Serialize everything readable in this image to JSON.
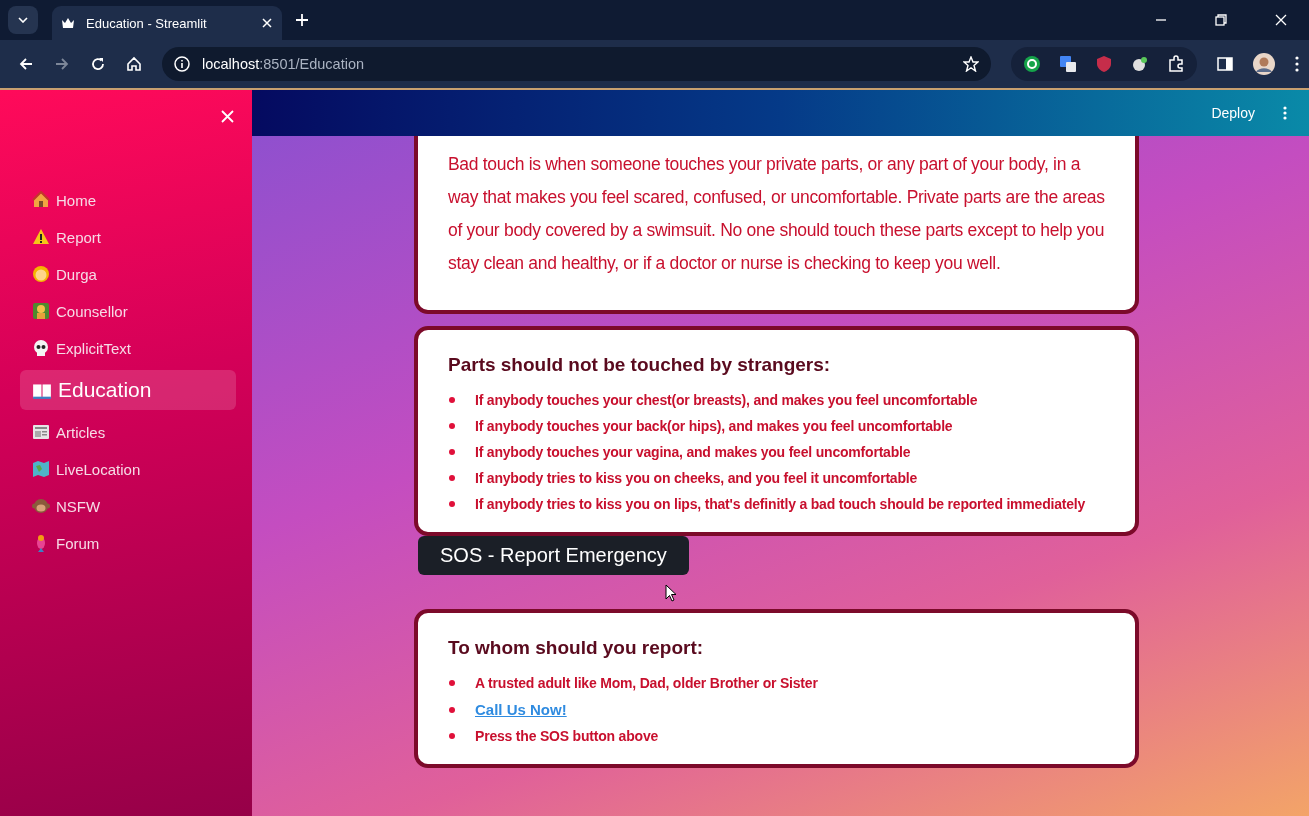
{
  "browser": {
    "tab_title": "Education - Streamlit",
    "url_host": "localhost",
    "url_path": ":8501/Education"
  },
  "sidebar": {
    "items": [
      {
        "label": "Home",
        "selected": false
      },
      {
        "label": "Report",
        "selected": false
      },
      {
        "label": "Durga",
        "selected": false
      },
      {
        "label": "Counsellor",
        "selected": false
      },
      {
        "label": "ExplicitText",
        "selected": false
      },
      {
        "label": "Education",
        "selected": true
      },
      {
        "label": "Articles",
        "selected": false
      },
      {
        "label": "LiveLocation",
        "selected": false
      },
      {
        "label": "NSFW",
        "selected": false
      },
      {
        "label": "Forum",
        "selected": false
      }
    ]
  },
  "header": {
    "deploy": "Deploy"
  },
  "blocks": [
    {
      "kind": "paragraph",
      "text": "Bad touch is when someone touches your private parts, or any part of your body, in a way that makes you feel scared, confused, or uncomfortable. Private parts are the areas of your body covered by a swimsuit. No one should touch these parts except to help you stay clean and healthy, or if a doctor or nurse is checking to keep you well."
    },
    {
      "kind": "list",
      "title": "Parts should not be touched by strangers:",
      "items": [
        {
          "kind": "text",
          "text": "If anybody touches your chest(or breasts), and makes you feel uncomfortable"
        },
        {
          "kind": "text",
          "text": "If anybody touches your back(or hips), and makes you feel uncomfortable"
        },
        {
          "kind": "text",
          "text": "If anybody touches your vagina, and makes you feel uncomfortable"
        },
        {
          "kind": "text",
          "text": "If anybody tries to kiss you on cheeks, and you feel it uncomfortable"
        },
        {
          "kind": "text",
          "text": "If anybody tries to kiss you on lips, that's definitly a bad touch should be reported immediately"
        }
      ]
    },
    {
      "kind": "button",
      "label": "SOS - Report Emergency"
    },
    {
      "kind": "list",
      "title": "To whom should you report:",
      "items": [
        {
          "kind": "text",
          "text": "A trusted adult like Mom, Dad, older Brother or Sister"
        },
        {
          "kind": "link",
          "text": "Call Us Now!"
        },
        {
          "kind": "text",
          "text": "Press the SOS button above"
        }
      ]
    }
  ]
}
